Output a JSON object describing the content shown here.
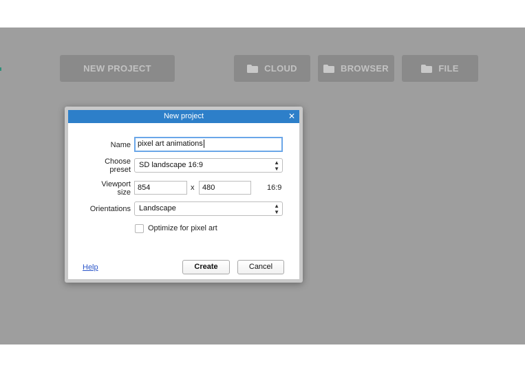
{
  "toolbar": {
    "new_project_label": "NEW PROJECT",
    "cloud_label": "CLOUD",
    "browser_label": "BROWSER",
    "file_label": "FILE"
  },
  "background": {
    "partial_text": "cts"
  },
  "dialog": {
    "title": "New project",
    "close_glyph": "✕",
    "name_label": "Name",
    "name_value": "pixel art animations",
    "preset_label_line1": "Choose",
    "preset_label_line2": "preset",
    "preset_value": "SD landscape 16:9",
    "viewport_label_line1": "Viewport",
    "viewport_label_line2": "size",
    "viewport_width": "854",
    "viewport_separator": "x",
    "viewport_height": "480",
    "aspect_ratio": "16:9",
    "orientations_label": "Orientations",
    "orientation_value": "Landscape",
    "pixel_art_label": "Optimize for pixel art",
    "pixel_art_checked": false,
    "help_label": "Help",
    "create_label": "Create",
    "cancel_label": "Cancel"
  },
  "colors": {
    "titlebar": "#2d7fc9",
    "backdrop": "#9e9e9e",
    "focus_ring": "#6aa6e8",
    "link": "#2a55c9"
  },
  "icons": {
    "folder": "folder-icon",
    "select_arrows": "updown-arrows-icon"
  }
}
